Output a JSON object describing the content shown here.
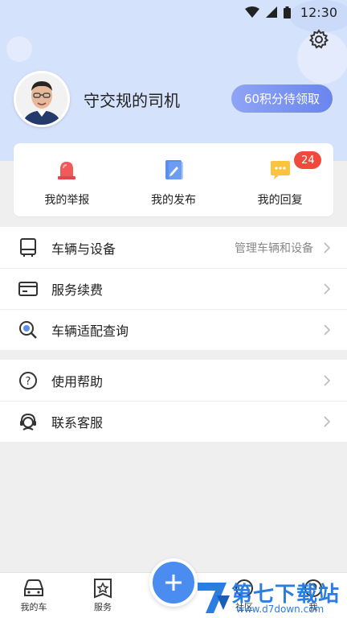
{
  "status_bar": {
    "time": "12:30"
  },
  "profile": {
    "username": "守交规的司机",
    "points_button": "60积分待领取"
  },
  "quick_actions": [
    {
      "label": "我的举报",
      "icon": "siren-icon"
    },
    {
      "label": "我的发布",
      "icon": "edit-note-icon"
    },
    {
      "label": "我的回复",
      "icon": "chat-bubble-icon",
      "badge": "24"
    }
  ],
  "menu_group_1": [
    {
      "label": "车辆与设备",
      "hint": "管理车辆和设备",
      "icon": "device-icon"
    },
    {
      "label": "服务续费",
      "hint": "",
      "icon": "card-icon"
    },
    {
      "label": "车辆适配查询",
      "hint": "",
      "icon": "search-icon"
    }
  ],
  "menu_group_2": [
    {
      "label": "使用帮助",
      "hint": "",
      "icon": "help-icon"
    },
    {
      "label": "联系客服",
      "hint": "",
      "icon": "headset-icon"
    }
  ],
  "bottom_nav": {
    "car": "我的车",
    "service": "服务",
    "community": "社区",
    "me": "我"
  },
  "watermark": {
    "title": "第七下载站",
    "url": "www.d7down.com"
  },
  "colors": {
    "accent": "#4a8cf0",
    "header_bg": "#d5e2fb",
    "badge": "#f04a3c"
  }
}
